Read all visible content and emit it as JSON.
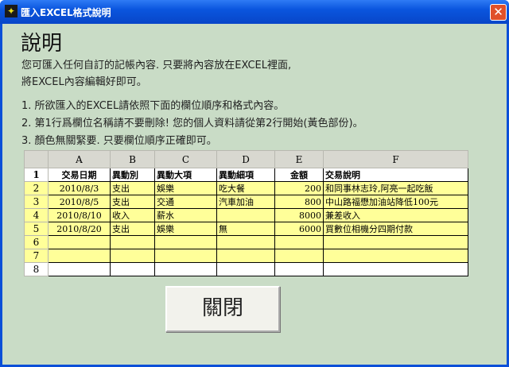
{
  "window": {
    "title": "匯入EXCEL格式說明",
    "close_glyph": "✕"
  },
  "heading": "說明",
  "intro": [
    "您可匯入任何自訂的記帳內容. 只要將內容放在EXCEL裡面,",
    "將EXCEL內容編輯好即可。"
  ],
  "steps": [
    "1. 所欲匯入的EXCEL請依照下面的欄位順序和格式內容。",
    "2. 第1行爲欄位名稱請不要刪除! 您的個人資料請從第2行開始(黃色部份)。",
    "3. 顏色無關緊要. 只要欄位順序正確即可。"
  ],
  "sheet": {
    "columns": [
      "A",
      "B",
      "C",
      "D",
      "E",
      "F"
    ],
    "row_numbers": [
      "1",
      "2",
      "3",
      "4",
      "5",
      "6",
      "7",
      "8"
    ],
    "header": [
      "交易日期",
      "異動別",
      "異動大項",
      "異動細項",
      "金額",
      "交易說明"
    ],
    "rows": [
      [
        "2010/8/3",
        "支出",
        "娛樂",
        "吃大餐",
        "200",
        "和同事林志玲,阿亮一起吃飯"
      ],
      [
        "2010/8/5",
        "支出",
        "交通",
        "汽車加油",
        "800",
        "中山路福懋加油站降低100元"
      ],
      [
        "2010/8/10",
        "收入",
        "薪水",
        "",
        "8000",
        "兼差收入"
      ],
      [
        "2010/8/20",
        "支出",
        "娛樂",
        "無",
        "6000",
        "買數位相機分四期付款"
      ]
    ]
  },
  "close_button": "關閉"
}
